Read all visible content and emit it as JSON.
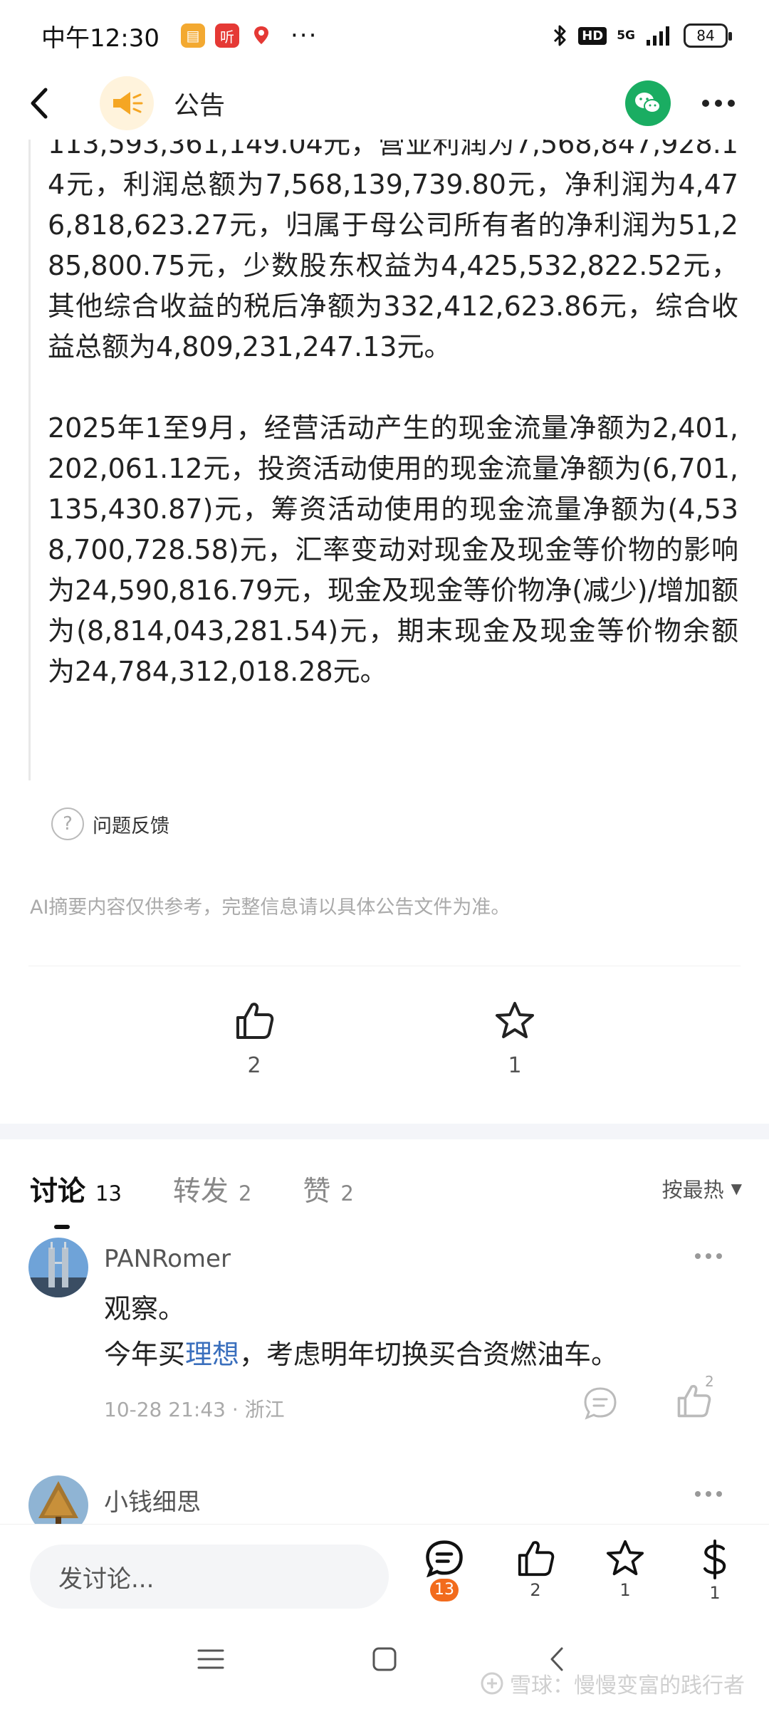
{
  "status_bar": {
    "time": "中午12:30",
    "app_badge_text": "听",
    "hd_label": "HD",
    "network": "5G",
    "battery": "84"
  },
  "header": {
    "title": "公告"
  },
  "article": {
    "paragraphs": [
      "113,593,361,149.04元，营业利润为7,568,847,928.14元，利润总额为7,568,139,739.80元，净利润为4,476,818,623.27元，归属于母公司所有者的净利润为51,285,800.75元，少数股东权益为4,425,532,822.52元，其他综合收益的税后净额为332,412,623.86元，综合收益总额为4,809,231,247.13元。",
      "2025年1至9月，经营活动产生的现金流量净额为2,401,202,061.12元，投资活动使用的现金流量净额为(6,701,135,430.87)元，筹资活动使用的现金流量净额为(4,538,700,728.58)元，汇率变动对现金及现金等价物的影响为24,590,816.79元，现金及现金等价物净(减少)/增加额为(8,814,043,281.54)元，期末现金及现金等价物余额为24,784,312,018.28元。"
    ],
    "feedback_label": "问题反馈",
    "disclaimer": "AI摘要内容仅供参考，完整信息请以具体公告文件为准。"
  },
  "reactions": {
    "like_count": "2",
    "favorite_count": "1"
  },
  "tabs": [
    {
      "label": "讨论",
      "count": "13"
    },
    {
      "label": "转发",
      "count": "2"
    },
    {
      "label": "赞",
      "count": "2"
    }
  ],
  "sort_label": "按最热",
  "comments": [
    {
      "user": "PANRomer",
      "line1": "观察。",
      "line2_before": "今年买",
      "line2_link": "理想",
      "line2_after": "，考虑明年切换买合资燃油车。",
      "time": "10-28 21:43",
      "location": "浙江",
      "like_count": "2"
    },
    {
      "user": "小钱细思"
    }
  ],
  "action_bar": {
    "input_placeholder": "发讨论...",
    "discuss_count": "13",
    "like_count": "2",
    "favorite_count": "1",
    "reward_count": "1"
  },
  "watermark": "雪球：慢慢变富的践行者",
  "colors": {
    "wechat": "#1aad62",
    "badge_orange": "#f26b1d",
    "link_blue": "#3a6fbd"
  }
}
